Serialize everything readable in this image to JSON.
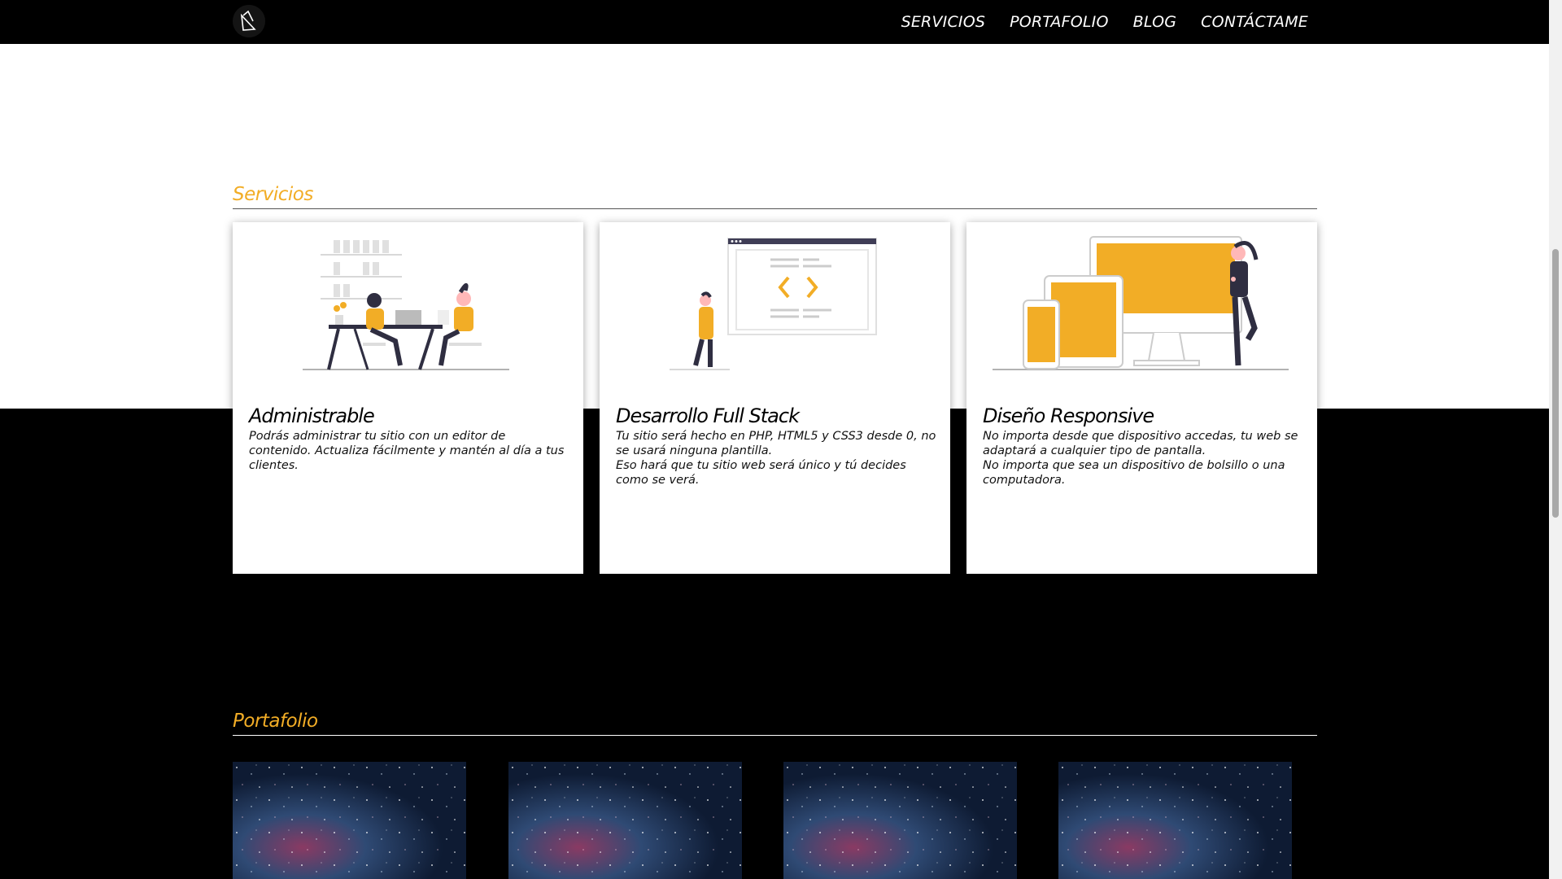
{
  "nav": {
    "logo_icon": "bird-logo-icon",
    "items": [
      {
        "label": "SERVICIOS"
      },
      {
        "label": "PORTAFOLIO"
      },
      {
        "label": "BLOG"
      },
      {
        "label": "CONTÁCTAME"
      }
    ]
  },
  "services": {
    "title": "Servicios",
    "cards": [
      {
        "icon": "team-working-illustration",
        "title": "Administrable",
        "lines": [
          "Podrás administrar tu sitio con un editor de contenido. Actualiza fácilmente y mantén al día a tus clientes."
        ]
      },
      {
        "icon": "code-window-illustration",
        "title": "Desarrollo Full Stack",
        "lines": [
          "Tu sitio será hecho en PHP, HTML5 y CSS3 desde 0, no se usará ninguna plantilla.",
          "Eso hará que tu sitio web será único y tú decides como se verá."
        ]
      },
      {
        "icon": "responsive-devices-illustration",
        "title": "Diseño Responsive",
        "lines": [
          "No importa desde que dispositivo accedas, tu web se adaptará a cualquier tipo de pantalla.",
          "No importa que sea un dispositivo de bolsillo o una computadora."
        ]
      }
    ]
  },
  "portfolio": {
    "title": "Portafolio",
    "items": [
      {
        "image": "galaxy-image"
      },
      {
        "image": "galaxy-image"
      },
      {
        "image": "galaxy-image"
      },
      {
        "image": "galaxy-image"
      }
    ]
  },
  "colors": {
    "accent": "#f2ad26",
    "dark": "#000000",
    "figure": "#2f2e41"
  }
}
